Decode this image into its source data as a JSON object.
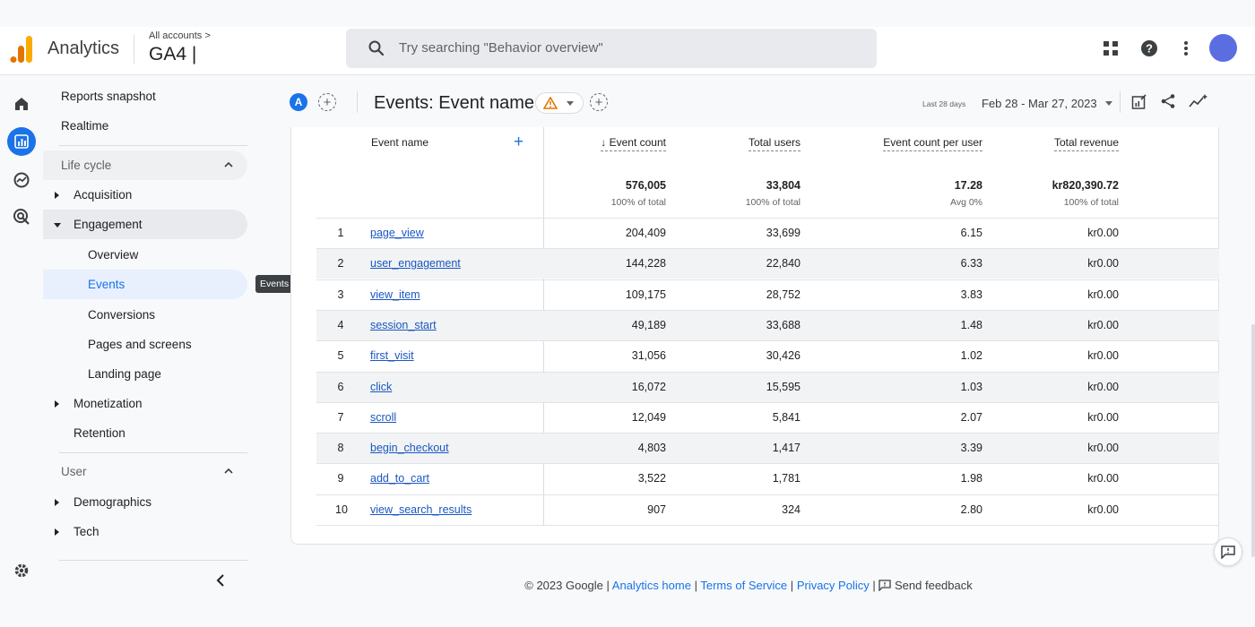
{
  "header": {
    "app_name": "Analytics",
    "account_crumb": "All accounts >",
    "property": "GA4 |",
    "search_placeholder": "Try searching \"Behavior overview\""
  },
  "rail": [
    "home-icon",
    "reports-icon",
    "explore-icon",
    "advertising-icon",
    "settings-icon"
  ],
  "sidebar": {
    "reports_snapshot": "Reports snapshot",
    "realtime": "Realtime",
    "life_cycle": "Life cycle",
    "acquisition": "Acquisition",
    "engagement": "Engagement",
    "overview": "Overview",
    "events": "Events",
    "conversions": "Conversions",
    "pages_and_screens": "Pages and screens",
    "landing_page": "Landing page",
    "monetization": "Monetization",
    "retention": "Retention",
    "user": "User",
    "demographics": "Demographics",
    "tech": "Tech",
    "tooltip": "Events"
  },
  "subheader": {
    "comparison_badge": "A",
    "title": "Events: Event name",
    "date_label": "Last 28 days",
    "date_range": "Feb 28 - Mar 27, 2023"
  },
  "table": {
    "headers": {
      "event_name": "Event name",
      "event_count": "↓ Event count",
      "total_users": "Total users",
      "per_user": "Event count per user",
      "revenue": "Total revenue"
    },
    "totals": {
      "event_count": "576,005",
      "event_count_sub": "100% of total",
      "total_users": "33,804",
      "total_users_sub": "100% of total",
      "per_user": "17.28",
      "per_user_sub": "Avg 0%",
      "revenue": "kr820,390.72",
      "revenue_sub": "100% of total"
    },
    "rows": [
      {
        "rank": "1",
        "name": "page_view",
        "count": "204,409",
        "users": "33,699",
        "per_user": "6.15",
        "revenue": "kr0.00"
      },
      {
        "rank": "2",
        "name": "user_engagement",
        "count": "144,228",
        "users": "22,840",
        "per_user": "6.33",
        "revenue": "kr0.00"
      },
      {
        "rank": "3",
        "name": "view_item",
        "count": "109,175",
        "users": "28,752",
        "per_user": "3.83",
        "revenue": "kr0.00"
      },
      {
        "rank": "4",
        "name": "session_start",
        "count": "49,189",
        "users": "33,688",
        "per_user": "1.48",
        "revenue": "kr0.00"
      },
      {
        "rank": "5",
        "name": "first_visit",
        "count": "31,056",
        "users": "30,426",
        "per_user": "1.02",
        "revenue": "kr0.00"
      },
      {
        "rank": "6",
        "name": "click",
        "count": "16,072",
        "users": "15,595",
        "per_user": "1.03",
        "revenue": "kr0.00"
      },
      {
        "rank": "7",
        "name": "scroll",
        "count": "12,049",
        "users": "5,841",
        "per_user": "2.07",
        "revenue": "kr0.00"
      },
      {
        "rank": "8",
        "name": "begin_checkout",
        "count": "4,803",
        "users": "1,417",
        "per_user": "3.39",
        "revenue": "kr0.00"
      },
      {
        "rank": "9",
        "name": "add_to_cart",
        "count": "3,522",
        "users": "1,781",
        "per_user": "1.98",
        "revenue": "kr0.00"
      },
      {
        "rank": "10",
        "name": "view_search_results",
        "count": "907",
        "users": "324",
        "per_user": "2.80",
        "revenue": "kr0.00"
      }
    ]
  },
  "footer": {
    "copyright": "© 2023 Google |",
    "analytics_home": "Analytics home",
    "sep1": "|",
    "terms": "Terms of Service",
    "sep2": "|",
    "privacy": "Privacy Policy",
    "sep3": "|",
    "send_feedback": "Send feedback"
  },
  "colors": {
    "accent": "#1a73e8",
    "logo_orange": "#f9ab00",
    "logo_dark_orange": "#e37400"
  }
}
